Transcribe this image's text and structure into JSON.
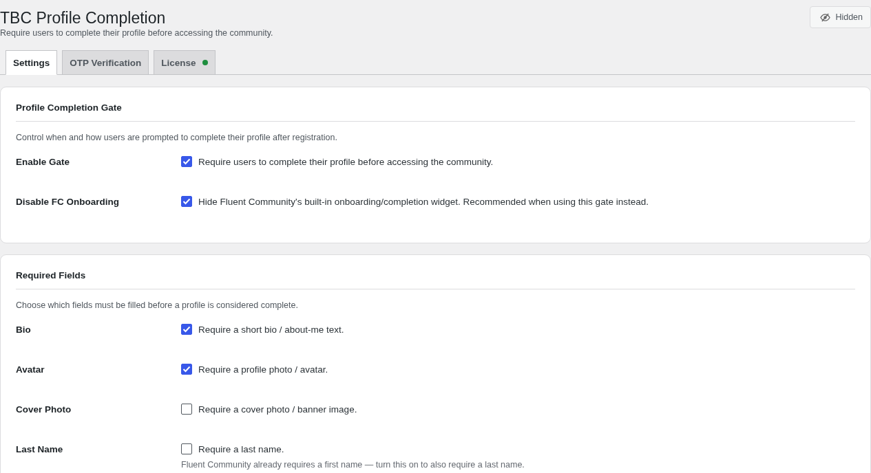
{
  "header": {
    "title": "TBC Profile Completion",
    "description": "Require users to complete their profile before accessing the community."
  },
  "visibility_button": {
    "label": "Hidden"
  },
  "tabs": [
    {
      "label": "Settings",
      "selected": true
    },
    {
      "label": "OTP Verification",
      "selected": false
    },
    {
      "label": "License",
      "selected": false,
      "status_dot": true
    }
  ],
  "sections": [
    {
      "title": "Profile Completion Gate",
      "description": "Control when and how users are prompted to complete their profile after registration.",
      "rows": [
        {
          "label": "Enable Gate",
          "checked": true,
          "text": "Require users to complete their profile before accessing the community."
        },
        {
          "label": "Disable FC Onboarding",
          "checked": true,
          "text": "Hide Fluent Community's built-in onboarding/completion widget. Recommended when using this gate instead."
        }
      ]
    },
    {
      "title": "Required Fields",
      "description": "Choose which fields must be filled before a profile is considered complete.",
      "rows": [
        {
          "label": "Bio",
          "checked": true,
          "text": "Require a short bio / about-me text."
        },
        {
          "label": "Avatar",
          "checked": true,
          "text": "Require a profile photo / avatar."
        },
        {
          "label": "Cover Photo",
          "checked": false,
          "text": "Require a cover photo / banner image."
        },
        {
          "label": "Last Name",
          "checked": false,
          "text": "Require a last name.",
          "note": "Fluent Community already requires a first name — turn this on to also require a last name."
        }
      ]
    }
  ]
}
